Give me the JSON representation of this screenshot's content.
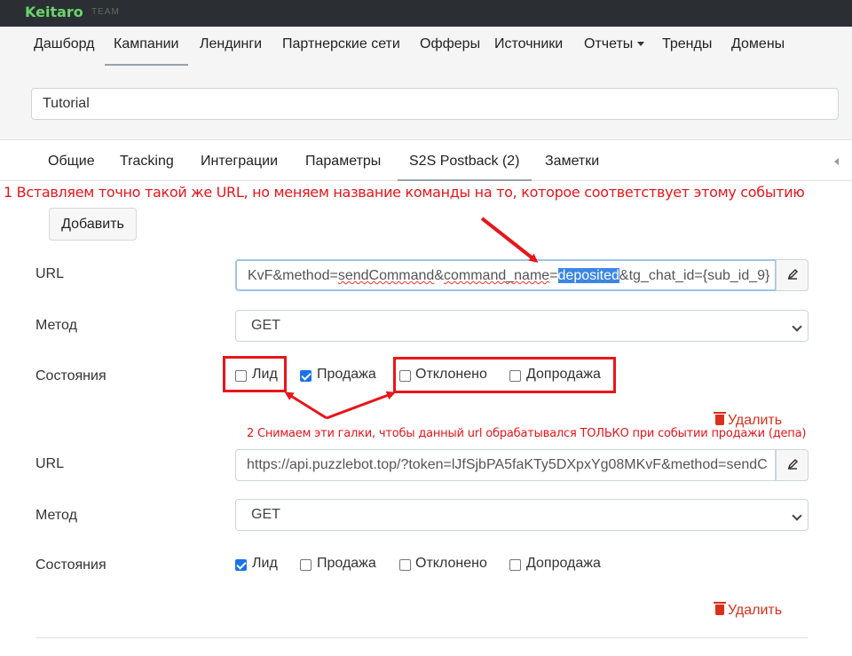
{
  "brand": {
    "name": "Keitaro",
    "edition": "TEAM"
  },
  "mainnav": {
    "items": [
      {
        "label": "Дашборд"
      },
      {
        "label": "Кампании"
      },
      {
        "label": "Лендинги"
      },
      {
        "label": "Партнерские сети"
      },
      {
        "label": "Офферы"
      },
      {
        "label": "Источники"
      },
      {
        "label": "Отчеты"
      },
      {
        "label": "Тренды"
      },
      {
        "label": "Домены"
      }
    ],
    "active": "Кампании"
  },
  "campaign": {
    "name": "Tutorial"
  },
  "tabs": {
    "items": [
      {
        "label": "Общие"
      },
      {
        "label": "Tracking"
      },
      {
        "label": "Интеграции"
      },
      {
        "label": "Параметры"
      },
      {
        "label": "S2S Postback (2)"
      },
      {
        "label": "Заметки"
      }
    ],
    "active": "S2S Postback (2)"
  },
  "annotations": {
    "note1": "1 Вставляем точно такой же URL, но меняем название команды на то, которое соответствует этому событию",
    "note2": "2 Снимаем эти галки, чтобы данный url обрабатывался ТОЛЬКО при событии продажи (депа)",
    "color": "#e8151b"
  },
  "add_button": "Добавить",
  "postbacks": [
    {
      "url_label": "URL",
      "url_parts": [
        "KvF&method=",
        "sendCommand",
        "&",
        "command_name",
        "=",
        "deposited",
        "&tg_chat_id={sub_id_9}"
      ],
      "method_label": "Метод",
      "method": "GET",
      "states_label": "Состояния",
      "states": [
        {
          "label": "Лид",
          "checked": false
        },
        {
          "label": "Продажа",
          "checked": true
        },
        {
          "label": "Отклонено",
          "checked": false
        },
        {
          "label": "Допродажа",
          "checked": false
        }
      ],
      "delete_label": "Удалить"
    },
    {
      "url_label": "URL",
      "url": "https://api.puzzlebot.top/?token=lJfSjbPA5faKTy5DXpxYg08MKvF&method=sendC",
      "method_label": "Метод",
      "method": "GET",
      "states_label": "Состояния",
      "states": [
        {
          "label": "Лид",
          "checked": true
        },
        {
          "label": "Продажа",
          "checked": false
        },
        {
          "label": "Отклонено",
          "checked": false
        },
        {
          "label": "Допродажа",
          "checked": false
        }
      ],
      "delete_label": "Удалить"
    }
  ],
  "icons": {
    "edit": "edit-icon",
    "delete": "trash-icon",
    "caret": "chevron-down-icon"
  }
}
